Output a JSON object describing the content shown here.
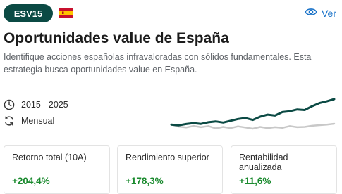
{
  "ticker": "ESV15",
  "flag_icon": "spain-flag-icon",
  "ver_label": "Ver",
  "title": "Oportunidades value de España",
  "description": "Identifique acciones españolas infravaloradas con sólidos fundamentales. Esta estrategia busca oportunidades value en España.",
  "period": "2015 - 2025",
  "frequency": "Mensual",
  "colors": {
    "badge": "#0b4a44",
    "strategy_line": "#0b4a44",
    "benchmark_line": "#c8c8c8",
    "positive": "#1a8a2e",
    "link": "#1a73c9"
  },
  "chart_data": {
    "type": "line",
    "series": [
      {
        "values": [
          0.0,
          -0.5,
          0.4,
          1.0,
          0.5,
          1.6,
          2.2,
          1.4,
          2.6,
          3.8,
          4.5,
          3.2,
          5.4,
          6.8,
          6.2,
          8.6,
          9.2,
          10.4,
          10.0,
          12.6,
          14.8,
          16.0,
          17.5
        ]
      },
      {
        "values": [
          0.0,
          -1.4,
          -2.0,
          -0.9,
          -1.8,
          -1.0,
          -2.6,
          -1.6,
          -2.4,
          -1.2,
          -2.0,
          -2.8,
          -1.6,
          -2.4,
          -1.8,
          -2.2,
          -1.0,
          -1.8,
          -1.6,
          -0.8,
          -0.4,
          0.0,
          0.6
        ]
      }
    ]
  },
  "metrics": [
    {
      "label": "Retorno total (10A)",
      "value": "+204,4%"
    },
    {
      "label": "Rendimiento superior",
      "value": "+178,3%"
    },
    {
      "label": "Rentabilidad anualizada",
      "value": "+11,6%"
    }
  ]
}
